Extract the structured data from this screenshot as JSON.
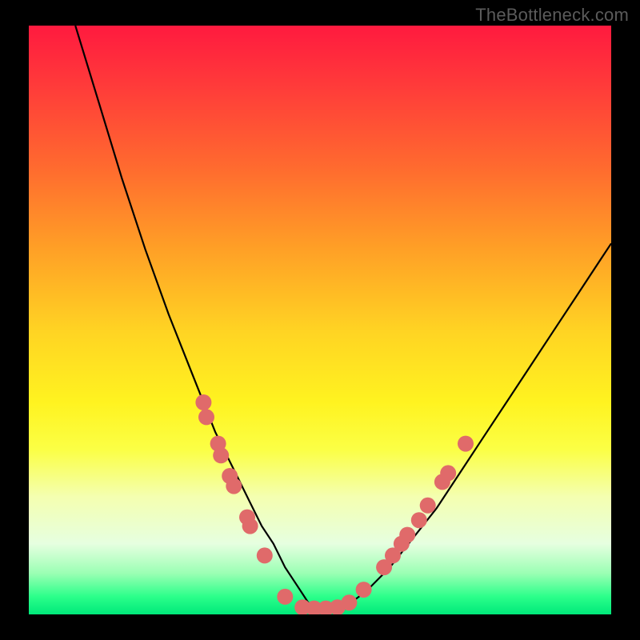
{
  "watermark": "TheBottleneck.com",
  "chart_data": {
    "type": "line",
    "title": "",
    "xlabel": "",
    "ylabel": "",
    "xlim": [
      0,
      100
    ],
    "ylim": [
      0,
      100
    ],
    "series": [
      {
        "name": "curve",
        "x": [
          8,
          12,
          16,
          20,
          24,
          28,
          30,
          32,
          34,
          36,
          38,
          40,
          42,
          44,
          46,
          48,
          50,
          54,
          58,
          62,
          66,
          70,
          74,
          78,
          82,
          86,
          90,
          94,
          98,
          100
        ],
        "y": [
          100,
          87,
          74,
          62,
          51,
          41,
          36,
          31,
          27,
          23,
          19,
          15,
          12,
          8,
          5,
          2,
          1,
          1,
          4,
          8,
          13,
          18,
          24,
          30,
          36,
          42,
          48,
          54,
          60,
          63
        ]
      }
    ],
    "markers": [
      {
        "x": 30.0,
        "y": 36.0
      },
      {
        "x": 30.5,
        "y": 33.5
      },
      {
        "x": 32.5,
        "y": 29.0
      },
      {
        "x": 33.0,
        "y": 27.0
      },
      {
        "x": 34.5,
        "y": 23.5
      },
      {
        "x": 35.2,
        "y": 21.8
      },
      {
        "x": 37.5,
        "y": 16.5
      },
      {
        "x": 38.0,
        "y": 15.0
      },
      {
        "x": 40.5,
        "y": 10.0
      },
      {
        "x": 44.0,
        "y": 3.0
      },
      {
        "x": 47.0,
        "y": 1.2
      },
      {
        "x": 49.0,
        "y": 1.0
      },
      {
        "x": 51.0,
        "y": 1.0
      },
      {
        "x": 53.0,
        "y": 1.2
      },
      {
        "x": 55.0,
        "y": 2.0
      },
      {
        "x": 57.5,
        "y": 4.2
      },
      {
        "x": 61.0,
        "y": 8.0
      },
      {
        "x": 62.5,
        "y": 10.0
      },
      {
        "x": 64.0,
        "y": 12.0
      },
      {
        "x": 65.0,
        "y": 13.5
      },
      {
        "x": 67.0,
        "y": 16.0
      },
      {
        "x": 68.5,
        "y": 18.5
      },
      {
        "x": 71.0,
        "y": 22.5
      },
      {
        "x": 72.0,
        "y": 24.0
      },
      {
        "x": 75.0,
        "y": 29.0
      }
    ],
    "marker_style": {
      "color": "#e06a6a",
      "radius_px": 10
    }
  }
}
